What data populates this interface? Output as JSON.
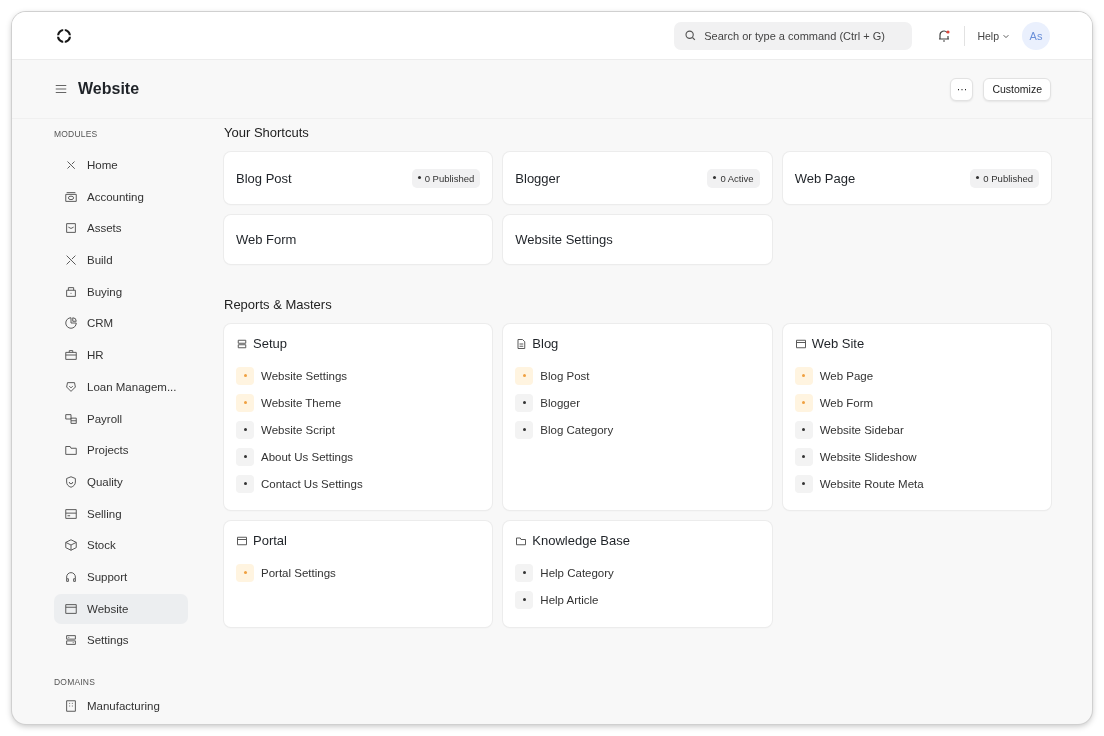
{
  "navbar": {
    "search": {
      "placeholder": "Search or type a command (Ctrl + G)"
    },
    "notifications": {
      "unread": true
    },
    "help": "Help",
    "avatar": "As"
  },
  "header": {
    "title": "Website",
    "more": "···",
    "customize": "Customize"
  },
  "sidebar": {
    "sections": [
      {
        "title": "MODULES",
        "items": [
          {
            "label": "Home",
            "selected": false
          },
          {
            "label": "Accounting",
            "selected": false
          },
          {
            "label": "Assets",
            "selected": false
          },
          {
            "label": "Build",
            "selected": false
          },
          {
            "label": "Buying",
            "selected": false
          },
          {
            "label": "CRM",
            "selected": false
          },
          {
            "label": "HR",
            "selected": false
          },
          {
            "label": "Loan Managem...",
            "selected": false
          },
          {
            "label": "Payroll",
            "selected": false
          },
          {
            "label": "Projects",
            "selected": false
          },
          {
            "label": "Quality",
            "selected": false
          },
          {
            "label": "Selling",
            "selected": false
          },
          {
            "label": "Stock",
            "selected": false
          },
          {
            "label": "Support",
            "selected": false
          },
          {
            "label": "Website",
            "selected": true
          },
          {
            "label": "Settings",
            "selected": false
          }
        ]
      },
      {
        "title": "DOMAINS",
        "items": [
          {
            "label": "Manufacturing",
            "selected": false
          }
        ]
      }
    ]
  },
  "shortcuts": {
    "title": "Your Shortcuts",
    "items": [
      {
        "label": "Blog Post",
        "badge": "0 Published"
      },
      {
        "label": "Blogger",
        "badge": "0 Active"
      },
      {
        "label": "Web Page",
        "badge": "0 Published"
      },
      {
        "label": "Web Form"
      },
      {
        "label": "Website Settings"
      }
    ]
  },
  "reports": {
    "title": "Reports & Masters",
    "cards": [
      {
        "title": "Setup",
        "links": [
          {
            "label": "Website Settings",
            "highlighted": true
          },
          {
            "label": "Website Theme",
            "highlighted": true
          },
          {
            "label": "Website Script",
            "highlighted": false
          },
          {
            "label": "About Us Settings",
            "highlighted": false
          },
          {
            "label": "Contact Us Settings",
            "highlighted": false
          }
        ]
      },
      {
        "title": "Blog",
        "links": [
          {
            "label": "Blog Post",
            "highlighted": true
          },
          {
            "label": "Blogger",
            "highlighted": false
          },
          {
            "label": "Blog Category",
            "highlighted": false
          }
        ]
      },
      {
        "title": "Web Site",
        "links": [
          {
            "label": "Web Page",
            "highlighted": true
          },
          {
            "label": "Web Form",
            "highlighted": true
          },
          {
            "label": "Website Sidebar",
            "highlighted": false
          },
          {
            "label": "Website Slideshow",
            "highlighted": false
          },
          {
            "label": "Website Route Meta",
            "highlighted": false
          }
        ]
      },
      {
        "title": "Portal",
        "links": [
          {
            "label": "Portal Settings",
            "highlighted": true
          }
        ]
      },
      {
        "title": "Knowledge Base",
        "links": [
          {
            "label": "Help Category",
            "highlighted": false
          },
          {
            "label": "Help Article",
            "highlighted": false
          }
        ]
      }
    ]
  }
}
